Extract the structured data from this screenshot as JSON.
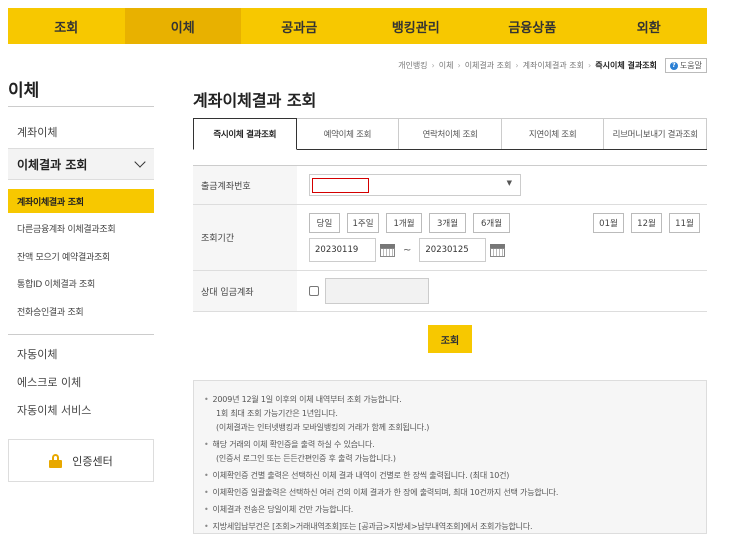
{
  "topnav": [
    "조회",
    "이체",
    "공과금",
    "뱅킹관리",
    "금융상품",
    "외환"
  ],
  "sidebar": {
    "title": "이체",
    "link1": "계좌이체",
    "group": "이체결과 조회",
    "subitems": [
      "계좌이체결과 조회",
      "다른금융계좌 이체결과조회",
      "잔액 모으기 예약결과조회",
      "통합ID 이체결과 조회",
      "전화승인결과 조회"
    ],
    "links": [
      "자동이체",
      "에스크로 이체",
      "자동이체 서비스"
    ],
    "cert": "인증센터"
  },
  "breadcrumb": [
    "개인뱅킹",
    "이체",
    "이체결과 조회",
    "계좌이체결과 조회",
    "즉시이체 결과조회"
  ],
  "help_label": "도움말",
  "page_title": "계좌이체결과 조회",
  "tabs": [
    "즉시이체 결과조회",
    "예약이체 조회",
    "연락처이체 조회",
    "지연이체 조회",
    "리브머니보내기 결과조회"
  ],
  "form": {
    "account_label": "출금계좌번호",
    "period_label": "조회기간",
    "period_buttons": [
      "당일",
      "1주일",
      "1개월",
      "3개월",
      "6개월"
    ],
    "month_buttons": [
      "01월",
      "12월",
      "11월"
    ],
    "date_from": "20230119",
    "date_to": "20230125",
    "tilde": "~",
    "counter_label": "상대 입금계좌"
  },
  "search_button": "조회",
  "notice": {
    "l1": "2009년 12월 1일 이후의 이체 내역부터 조회 가능합니다.",
    "l1a": "1회 최대 조회 가능기간은 1년입니다.",
    "l1b": "(이체결과는 인터넷뱅킹과 모바일뱅킹의 거래가 함께 조회됩니다.)",
    "l2": "해당 거래의 이체 확인증을 출력 하실 수 있습니다.",
    "l2a": "(인증서 로그인 또는 든든간편인증 후 출력 가능합니다.)",
    "l3": "이체확인증 건별 출력은 선택하신 이체 결과 내역이 건별로 한 장씩 출력됩니다. (최대 10건)",
    "l4": "이체확인증 일괄출력은 선택하신 여러 건의 이체 결과가 한 장에 출력되며, 최대 10건까지 선택 가능합니다.",
    "l5": "이체결과 전송은 당일이체 건만 가능합니다.",
    "l6": "지방세입납부건은 [조회>거래내역조회]또는 [공과금>지방세>납부내역조회]에서 조회가능합니다."
  }
}
